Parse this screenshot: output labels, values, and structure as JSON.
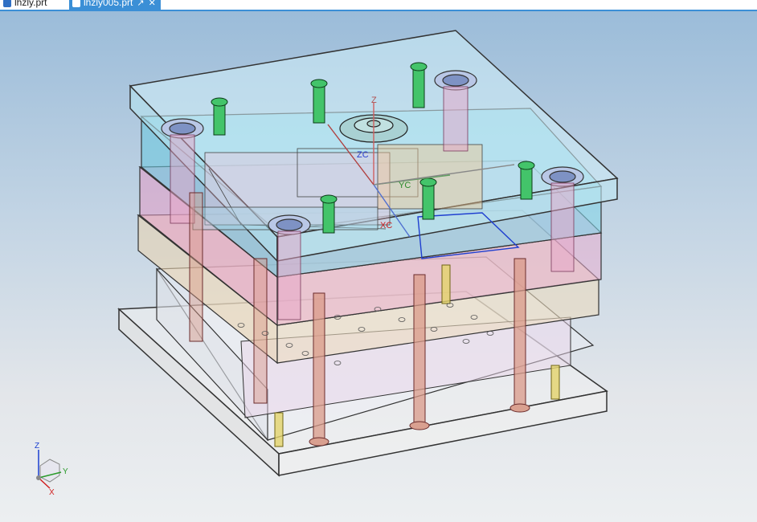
{
  "tabs": [
    {
      "label": "lhzly.prt",
      "active": false,
      "icon": "part-file-icon"
    },
    {
      "label": "lhzly005.prt",
      "active": true,
      "icon": "part-file-icon"
    }
  ],
  "tab_buttons": {
    "undock_icon": "↗",
    "close_icon": "✕"
  },
  "wcs": {
    "z": "Z",
    "zc": "ZC",
    "yc": "YC",
    "xc": "XC"
  },
  "triad": {
    "z": "Z",
    "y": "Y",
    "x": "X"
  },
  "colors": {
    "accent": "#3b8fd6",
    "background_top": "#9bbcd9",
    "background_bottom": "#eceff1"
  }
}
